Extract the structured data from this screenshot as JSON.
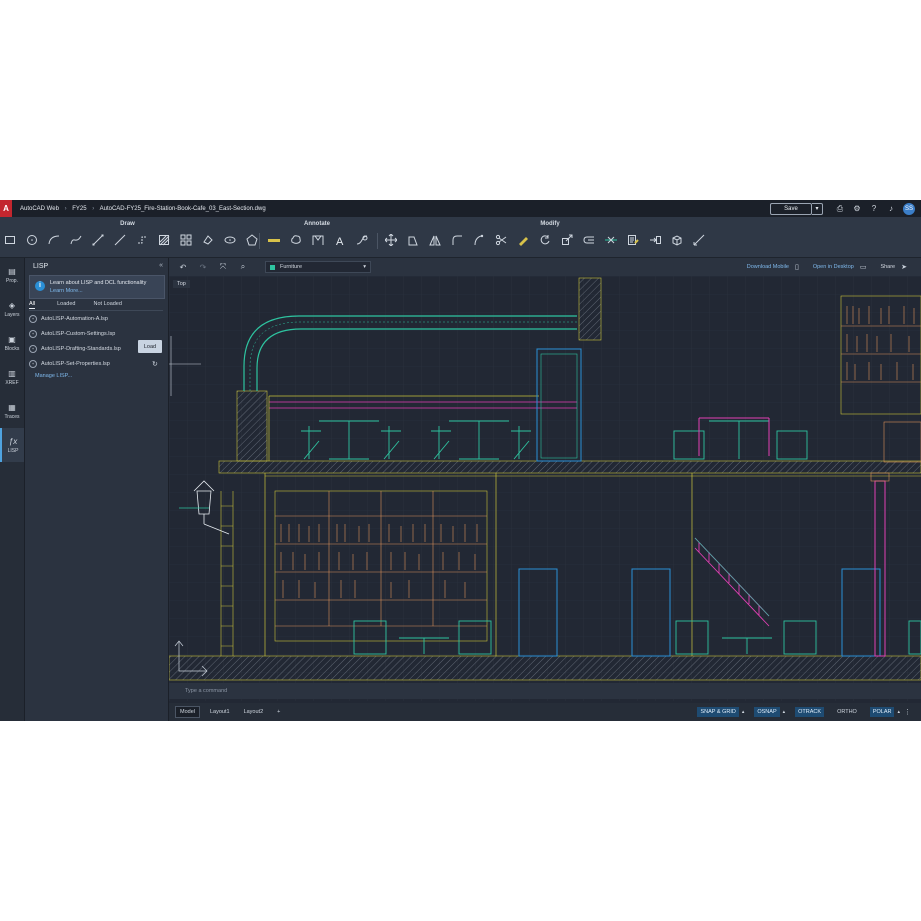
{
  "titlebar": {
    "logo": "A",
    "app": "AutoCAD Web",
    "folder": "FY25",
    "file": "AutoCAD-FY25_Fire-Station-Book-Cafe_03_East-Section.dwg",
    "save": "Save",
    "avatar": "SS"
  },
  "ribbon": {
    "groups": [
      {
        "label": "Draw"
      },
      {
        "label": "Annotate"
      },
      {
        "label": "Modify"
      }
    ]
  },
  "strip": {
    "items": [
      {
        "label": "Prop.",
        "icon": "properties-icon"
      },
      {
        "label": "Layers",
        "icon": "layers-icon"
      },
      {
        "label": "Blocks",
        "icon": "blocks-icon"
      },
      {
        "label": "XREF",
        "icon": "xref-icon"
      },
      {
        "label": "Traces",
        "icon": "traces-icon"
      },
      {
        "label": "LISP",
        "icon": "lisp-icon"
      }
    ]
  },
  "panel": {
    "title": "LISP",
    "info_line1": "Learn about LISP and DCL functionality",
    "info_link": "Learn More...",
    "filters": [
      "All",
      "Loaded",
      "Not Loaded"
    ],
    "files": [
      "AutoLISP-Automation-A.lsp",
      "AutoLISP-Custom-Settings.lsp",
      "AutoLISP-Drafting-Standards.lsp",
      "AutoLISP-Set-Properties.lsp"
    ],
    "load_tooltip": "Load",
    "manage": "Manage LISP..."
  },
  "canvas": {
    "layer": "Furniture",
    "download_mobile": "Download Mobile",
    "open_desktop": "Open in Desktop",
    "share": "Share",
    "view": "Top"
  },
  "command": {
    "placeholder": "Type a command"
  },
  "status": {
    "tabs": [
      "Model",
      "Layout1",
      "Layout2"
    ],
    "add": "+",
    "toggles": [
      "SNAP & GRID",
      "OSNAP",
      "OTRACK",
      "ORTHO",
      "POLAR"
    ],
    "more": "⋮"
  },
  "colors": {
    "accent": "#4fa3e0",
    "cyan": "#2ec4a0",
    "magenta": "#e23fb4",
    "yellow": "#d8d23a"
  }
}
